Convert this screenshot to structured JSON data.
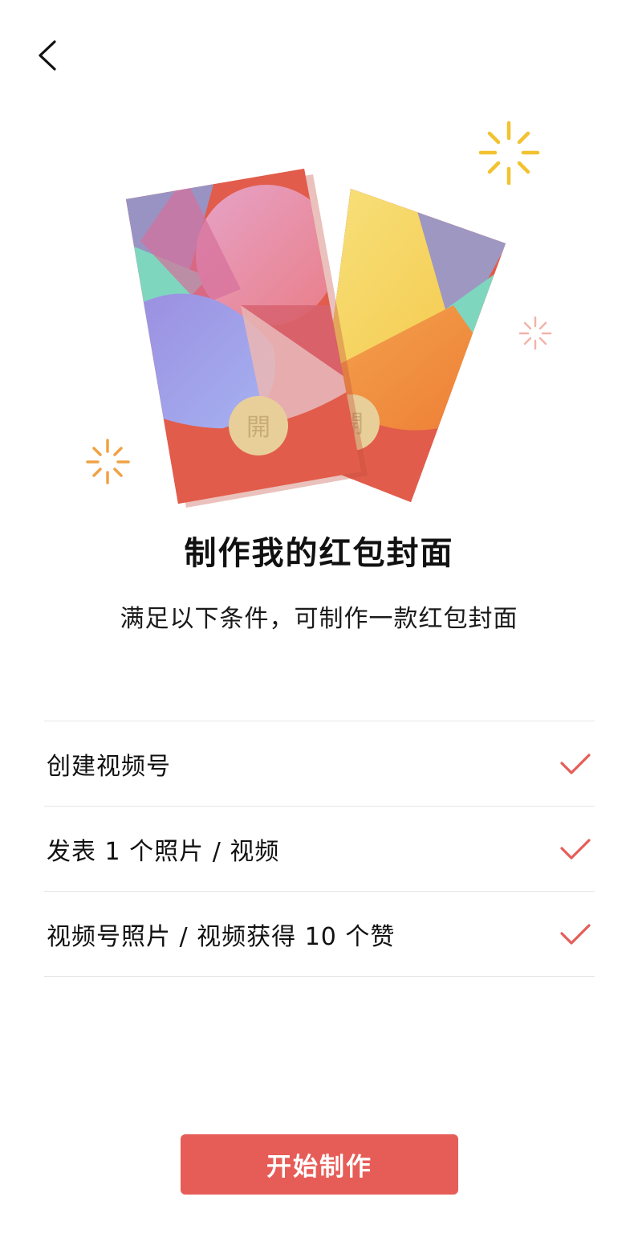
{
  "header": {
    "back_icon": "chevron-left-icon"
  },
  "illustration": {
    "badge_char": "開",
    "colors": {
      "red": "#e15c4b",
      "pink": "#e6839e",
      "purple": "#9b90c0",
      "mint": "#7fd6bf",
      "yellow": "#f5d258",
      "orange": "#ef8a3e",
      "gold_badge": "#e8cf9a",
      "spark_yellow": "#f2c230",
      "spark_orange": "#f0a245",
      "spark_pink": "#f1b3a8"
    }
  },
  "main": {
    "title": "制作我的红包封面",
    "subtitle": "满足以下条件，可制作一款红包封面"
  },
  "requirements": [
    {
      "label": "创建视频号",
      "done": true,
      "icon": "check-icon"
    },
    {
      "label": "发表 1 个照片 / 视频",
      "done": true,
      "icon": "check-icon"
    },
    {
      "label": "视频号照片 / 视频获得 10 个赞",
      "done": true,
      "icon": "check-icon"
    }
  ],
  "actions": {
    "start_label": "开始制作",
    "accent": "#e65d58"
  }
}
